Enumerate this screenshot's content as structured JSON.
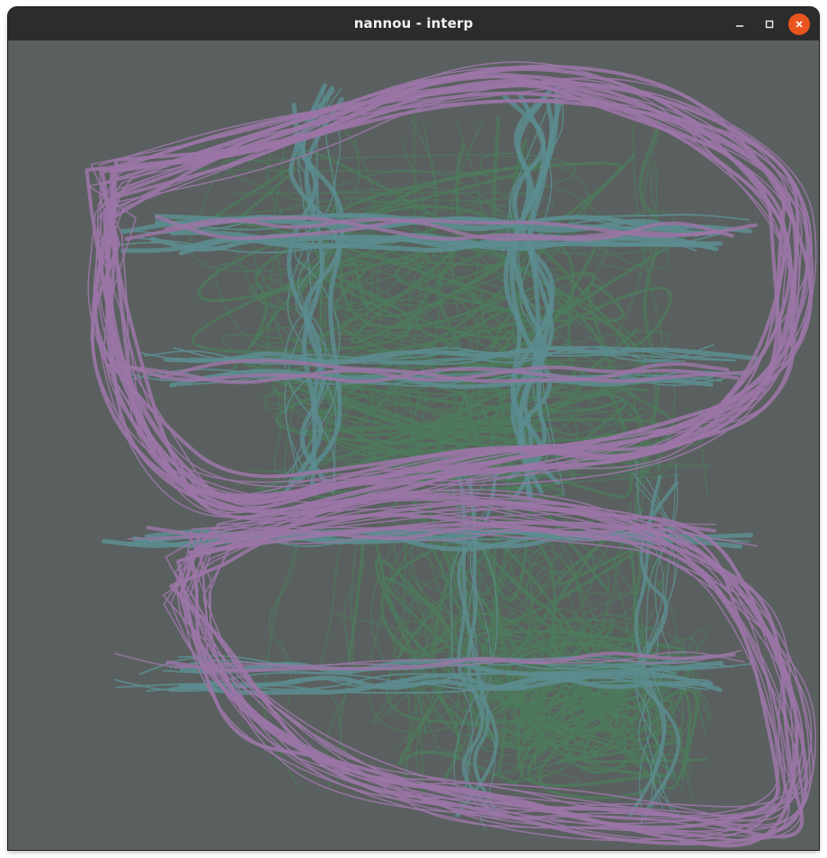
{
  "window": {
    "title": "nannou - interp"
  },
  "titlebar_controls": [
    {
      "name": "minimize",
      "icon": "minimize-icon"
    },
    {
      "name": "maximize",
      "icon": "maximize-icon"
    },
    {
      "name": "close",
      "icon": "close-icon"
    }
  ],
  "colors": {
    "titlebar": "#2c2c2c",
    "title_text": "#f2f2f2",
    "canvas_background": "#5a605f",
    "close_button": "#e9541f",
    "stroke_purple": "#9a76a6",
    "stroke_teal": "#5c8c8f",
    "stroke_green": "#4d7a5c"
  }
}
